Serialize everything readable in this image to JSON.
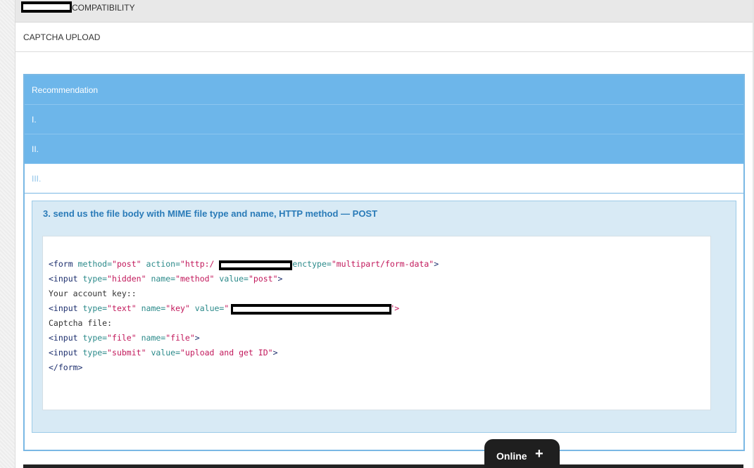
{
  "sections": {
    "compatibility_label": "COMPATIBILITY",
    "captcha_upload_label": "CAPTCHA UPLOAD"
  },
  "recommendation": {
    "header": "Recommendation",
    "items": [
      "I.",
      "II.",
      "III."
    ]
  },
  "step": {
    "title": "3. send us the file body with MIME file type and name, HTTP method — POST"
  },
  "code": {
    "l1": {
      "open": "<form ",
      "a1": "method",
      "eq1": "=",
      "v1": "\"post\"",
      "a2": "action",
      "eq2": "=",
      "v2": "\"http:/",
      "a3": "enctype",
      "eq3": "=",
      "v3": "\"multipart/form-data\"",
      "close": ">"
    },
    "l2": {
      "open": "<input ",
      "a1": "type",
      "v1": "\"hidden\"",
      "a2": "name",
      "v2": "\"method\"",
      "a3": "value",
      "v3": "\"post\"",
      "close": ">"
    },
    "l3": "Your account key::",
    "l4": {
      "open": "<input ",
      "a1": "type",
      "v1": "\"text\"",
      "a2": "name",
      "v2": "\"key\"",
      "a3": "value",
      "v3": "\"",
      "close": "\">"
    },
    "l5": "Captcha file:",
    "l6": {
      "open": "<input ",
      "a1": "type",
      "v1": "\"file\"",
      "a2": "name",
      "v2": "\"file\"",
      "close": ">"
    },
    "l7": {
      "open": "<input ",
      "a1": "type",
      "v1": "\"submit\"",
      "a2": "value",
      "v2": "\"upload and get ID\"",
      "close": ">"
    },
    "l8": "</form>"
  },
  "chat": {
    "label": "Online",
    "plus": "+"
  }
}
